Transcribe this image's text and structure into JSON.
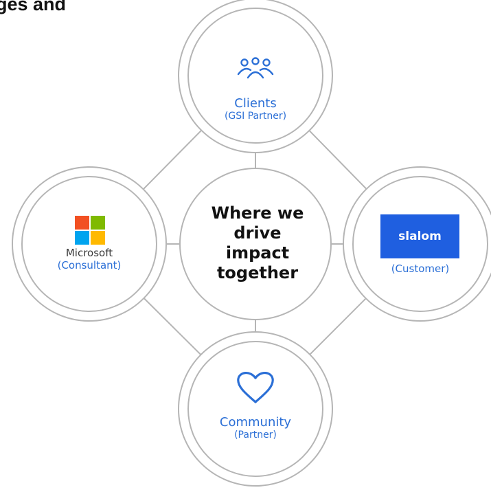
{
  "heading": "ges and",
  "center": {
    "lines": [
      "Where we",
      "drive",
      "impact",
      "together"
    ]
  },
  "nodes": {
    "top": {
      "label": "Clients",
      "sublabel": "(GSI Partner)",
      "icon": "people-icon"
    },
    "left": {
      "brand": "Microsoft",
      "sublabel": "(Consultant)",
      "icon": "microsoft-logo"
    },
    "right": {
      "brand": "slalom",
      "sublabel": "(Customer)",
      "icon": "slalom-logo"
    },
    "bottom": {
      "label": "Community",
      "sublabel": "(Partner)",
      "icon": "heart-icon"
    }
  },
  "colors": {
    "accent": "#2b6fd6",
    "ring": "#b5b5b5",
    "slalom": "#1f5fe0",
    "ms_red": "#f25022",
    "ms_green": "#7fba00",
    "ms_blue": "#00a4ef",
    "ms_yellow": "#ffb900"
  }
}
